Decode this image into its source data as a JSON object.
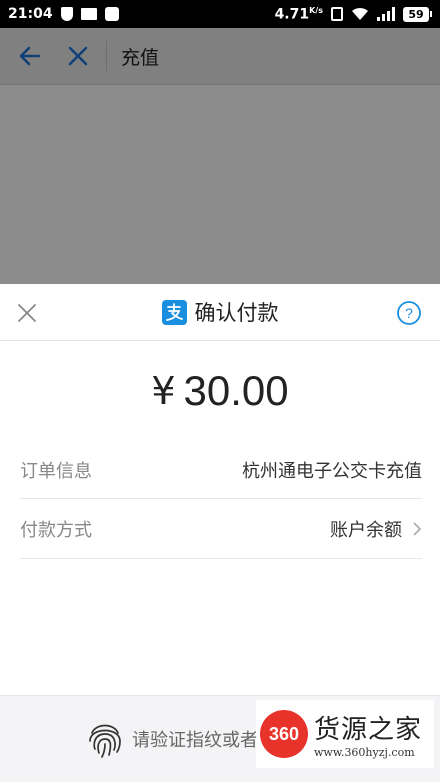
{
  "status_bar": {
    "time": "21:04",
    "speed": "4.71",
    "speed_unit": "K/s",
    "battery": "59"
  },
  "app_bar": {
    "title": "充值",
    "back_icon": "back-arrow-icon",
    "close_icon": "close-icon"
  },
  "sheet": {
    "title": "确认付款",
    "currency": "¥",
    "amount": "30.00",
    "rows": [
      {
        "label": "订单信息",
        "value": "杭州通电子公交卡充值"
      },
      {
        "label": "付款方式",
        "value": "账户余额"
      }
    ],
    "fingerprint_text": "请验证指纹或者"
  },
  "watermark": {
    "badge": "360",
    "name": "货源之家",
    "url": "www.360hyzj.com"
  },
  "colors": {
    "accent": "#1a8fdf",
    "overlay": "rgba(0,0,0,0.45)"
  }
}
